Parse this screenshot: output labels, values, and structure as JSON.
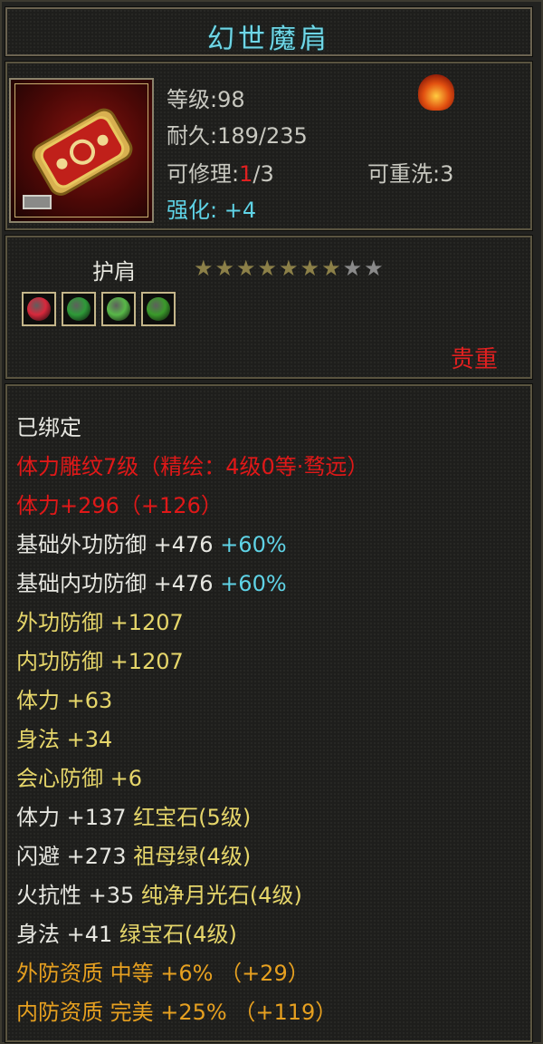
{
  "item": {
    "title": "幻世魔肩",
    "level_label": "等级",
    "level_value": ":98",
    "durability_label": "耐久",
    "durability_value": ":189/235",
    "repair_label": "可修理",
    "repair_current": "1",
    "repair_max": "/3",
    "rewash_label": "可重洗",
    "rewash_value": ":3",
    "enhance_label": "强化",
    "enhance_value": ": +4",
    "slot_name": "护肩",
    "stars_total": 9,
    "stars_filled": 7,
    "quality": "贵重",
    "icon": "pauldron-icon",
    "element_icon": "fire-element-icon",
    "gems": [
      {
        "name": "ruby-gem-icon",
        "color": "#d8283c"
      },
      {
        "name": "emerald-gem-icon",
        "color": "#2e9a38"
      },
      {
        "name": "moonstone-gem-icon",
        "color": "#58b848"
      },
      {
        "name": "peridot-gem-icon",
        "color": "#3a9a2a"
      }
    ]
  },
  "attributes": [
    {
      "text": "已绑定",
      "extra": "",
      "color": "white"
    },
    {
      "text": "体力雕纹7级（精绘：4级0等·骛远）",
      "extra": "",
      "color": "redt"
    },
    {
      "text": "体力+296（+126）",
      "extra": "",
      "color": "redt"
    },
    {
      "text": "基础外功防御 +476 ",
      "extra": "+60%",
      "color": "white"
    },
    {
      "text": "基础内功防御 +476 ",
      "extra": "+60%",
      "color": "white"
    },
    {
      "text": "外功防御 +1207",
      "extra": "",
      "color": "yellow"
    },
    {
      "text": "内功防御 +1207",
      "extra": "",
      "color": "yellow"
    },
    {
      "text": "体力 +63",
      "extra": "",
      "color": "yellow"
    },
    {
      "text": "身法 +34",
      "extra": "",
      "color": "yellow"
    },
    {
      "text": "会心防御 +6",
      "extra": "",
      "color": "yellow"
    },
    {
      "text": "体力 +137 ",
      "extra": "红宝石(5级)",
      "color": "white"
    },
    {
      "text": "闪避 +273 ",
      "extra": "祖母绿(4级)",
      "color": "white"
    },
    {
      "text": "火抗性 +35 ",
      "extra": "纯净月光石(4级)",
      "color": "white"
    },
    {
      "text": "身法 +41 ",
      "extra": "绿宝石(4级)",
      "color": "white"
    },
    {
      "text": "外防资质  中等 +6% （+29）",
      "extra": "",
      "color": "orange"
    },
    {
      "text": "内防资质  完美 +25% （+119）",
      "extra": "",
      "color": "orange"
    }
  ]
}
